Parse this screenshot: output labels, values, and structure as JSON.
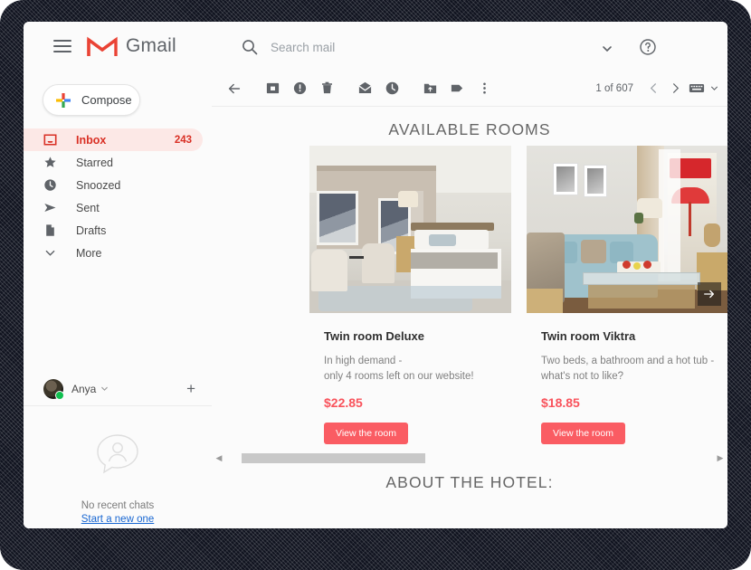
{
  "app": {
    "brand": "Gmail",
    "menu_icon": "hamburger-icon",
    "logo_icon": "gmail-m-logo"
  },
  "search": {
    "placeholder": "Search mail",
    "value": "",
    "icon": "search-icon",
    "options_icon": "chevron-down-icon",
    "help_icon": "help-circle-icon"
  },
  "compose": {
    "label": "Compose",
    "icon": "plus-icon"
  },
  "sidebar": {
    "items": [
      {
        "label": "Inbox",
        "icon": "inbox-icon",
        "count": "243",
        "active": true
      },
      {
        "label": "Starred",
        "icon": "star-icon",
        "count": "",
        "active": false
      },
      {
        "label": "Snoozed",
        "icon": "clock-icon",
        "count": "",
        "active": false
      },
      {
        "label": "Sent",
        "icon": "send-icon",
        "count": "",
        "active": false
      },
      {
        "label": "Drafts",
        "icon": "document-icon",
        "count": "",
        "active": false
      },
      {
        "label": "More",
        "icon": "chevron-down-icon",
        "count": "",
        "active": false
      }
    ],
    "chat": {
      "user_name": "Anya",
      "status": "online",
      "caret_icon": "chevron-down-icon",
      "add_icon": "plus-icon",
      "empty_icon": "chat-person-icon",
      "empty_text": "No recent chats",
      "empty_link": "Start a new one"
    }
  },
  "toolbar": {
    "actions": [
      {
        "name": "back-button",
        "icon": "arrow-left-icon"
      },
      {
        "name": "archive-button",
        "icon": "archive-icon"
      },
      {
        "name": "report-spam-button",
        "icon": "report-spam-icon"
      },
      {
        "name": "delete-button",
        "icon": "trash-icon"
      },
      {
        "name": "mark-unread-button",
        "icon": "mail-icon"
      },
      {
        "name": "snooze-button",
        "icon": "clock-icon"
      },
      {
        "name": "move-to-button",
        "icon": "folder-move-icon"
      },
      {
        "name": "labels-button",
        "icon": "label-icon"
      },
      {
        "name": "more-options-button",
        "icon": "more-vertical-icon"
      }
    ],
    "pagination": {
      "count_text": "1 of 607",
      "prev_icon": "chevron-left-icon",
      "next_icon": "chevron-right-icon",
      "input_tools_icon": "keyboard-icon",
      "input_tools_caret": "chevron-down-icon"
    }
  },
  "email": {
    "section_title": "AVAILABLE ROOMS",
    "section_title_2": "ABOUT THE HOTEL:",
    "rooms": [
      {
        "name": "Twin room Deluxe",
        "desc_line1": "In high demand -",
        "desc_line2": "only 4 rooms left on our website!",
        "price": "$22.85",
        "cta": "View the room",
        "image_alt": "hotel-bedroom-photo"
      },
      {
        "name": "Twin room Viktra",
        "desc_line1": "Two beds, a bathroom and a hot tub -",
        "desc_line2": "what's not to like?",
        "price": "$18.85",
        "cta": "View the room",
        "image_alt": "hotel-living-room-photo"
      }
    ],
    "carousel_next_icon": "arrow-right-icon",
    "scrollbar": {
      "left_icon": "triangle-left-icon",
      "right_icon": "triangle-right-icon"
    }
  },
  "colors": {
    "accent_red": "#d93025",
    "inbox_bg": "#fce8e6",
    "cta": "#fa5c63",
    "price": "#f9535c",
    "link_blue": "#1967d2"
  }
}
